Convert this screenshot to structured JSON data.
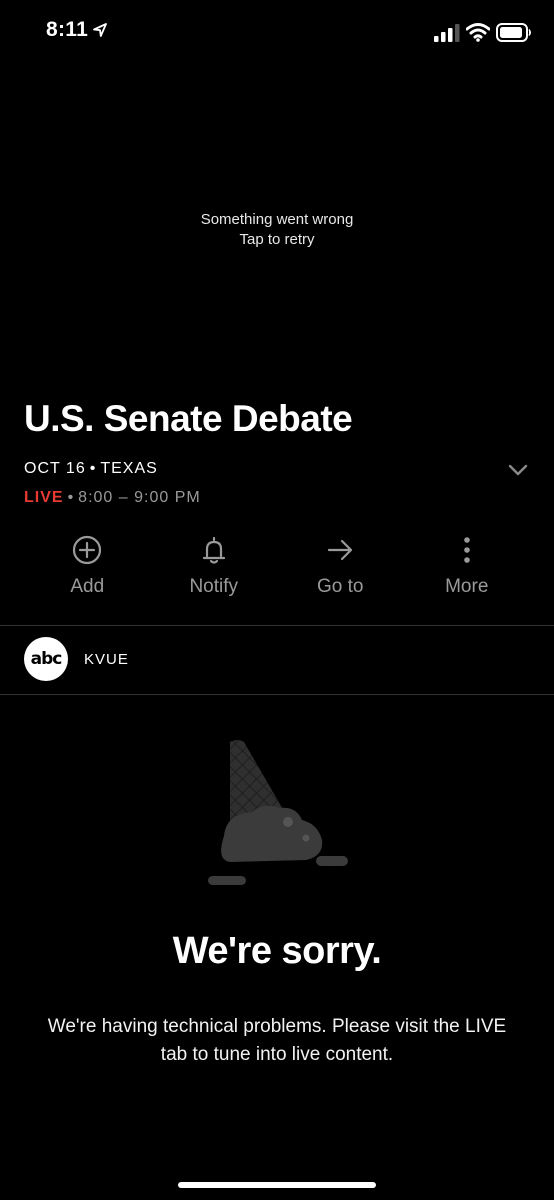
{
  "status_bar": {
    "time": "8:11",
    "icons": [
      "location-arrow-icon",
      "cellular-signal-icon",
      "wifi-icon",
      "battery-icon"
    ]
  },
  "player": {
    "error_line1": "Something went wrong",
    "error_line2": "Tap to retry"
  },
  "event": {
    "title": "U.S. Senate Debate",
    "date": "OCT 16",
    "location": "TEXAS",
    "live_label": "LIVE",
    "time_range": "8:00 – 9:00 PM",
    "separator": "•",
    "expand_icon": "chevron-down-icon"
  },
  "actions": [
    {
      "label": "Add",
      "icon": "plus-circle-icon"
    },
    {
      "label": "Notify",
      "icon": "bell-icon"
    },
    {
      "label": "Go to",
      "icon": "arrow-right-icon"
    },
    {
      "label": "More",
      "icon": "more-vertical-icon"
    }
  ],
  "channel": {
    "logo_text": "abc",
    "name": "KVUE"
  },
  "error_screen": {
    "illustration": "dropped-ice-cream-cone",
    "title": "We're sorry.",
    "message": "We're having technical problems.  Please visit the LIVE tab to tune into live content."
  },
  "colors": {
    "background": "#000000",
    "live_red": "#e63a32",
    "muted_text": "#9a9a9a",
    "divider": "#333333"
  }
}
